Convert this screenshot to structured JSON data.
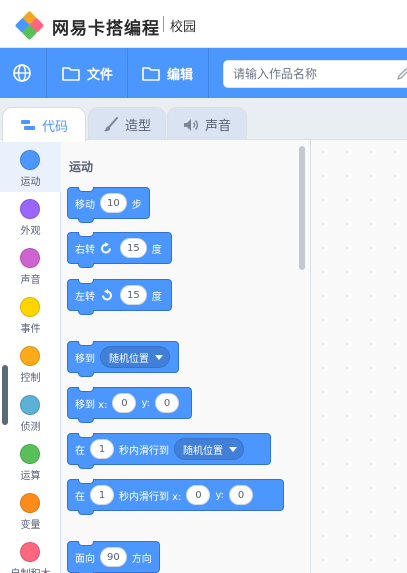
{
  "brand": {
    "name": "网易卡搭编程",
    "sub": "校园"
  },
  "menu": {
    "file_label": "文件",
    "edit_label": "编辑",
    "title_placeholder": "请输入作品名称"
  },
  "tabs": [
    {
      "label": "代码",
      "icon": "code-icon",
      "active": true
    },
    {
      "label": "造型",
      "icon": "brush-icon",
      "active": false
    },
    {
      "label": "声音",
      "icon": "speaker-icon",
      "active": false
    }
  ],
  "categories": [
    {
      "label": "运动",
      "color": "#4c97ff",
      "active": true
    },
    {
      "label": "外观",
      "color": "#9966ff",
      "active": false
    },
    {
      "label": "声音",
      "color": "#cf63cf",
      "active": false
    },
    {
      "label": "事件",
      "color": "#ffd500",
      "active": false
    },
    {
      "label": "控制",
      "color": "#ffab19",
      "active": false
    },
    {
      "label": "侦测",
      "color": "#5cb1d6",
      "active": false
    },
    {
      "label": "运算",
      "color": "#59c059",
      "active": false
    },
    {
      "label": "变量",
      "color": "#ff8c1a",
      "active": false
    },
    {
      "label": "自制积木",
      "color": "#ff6680",
      "active": false
    }
  ],
  "palette": {
    "title": "运动",
    "blocks": {
      "move": {
        "label": "移动",
        "value": "10",
        "suffix": "步"
      },
      "turn_right": {
        "label": "右转",
        "value": "15",
        "suffix": "度"
      },
      "turn_left": {
        "label": "左转",
        "value": "15",
        "suffix": "度"
      },
      "goto": {
        "label": "移到",
        "dropdown": "随机位置"
      },
      "goto_xy": {
        "label": "移到 x:",
        "x": "0",
        "ylabel": "y:",
        "y": "0"
      },
      "glide": {
        "label": "在",
        "secs": "1",
        "mid": "秒内滑行到",
        "dropdown": "随机位置"
      },
      "glide_xy": {
        "label": "在",
        "secs": "1",
        "mid": "秒内滑行到 x:",
        "x": "0",
        "ylabel": "y:",
        "y": "0"
      },
      "point": {
        "label": "面向",
        "value": "90",
        "suffix": "方向"
      }
    }
  },
  "colors": {
    "accent": "#4c97ff",
    "motion_block": "#4c97ff",
    "motion_border": "#3373cc"
  }
}
